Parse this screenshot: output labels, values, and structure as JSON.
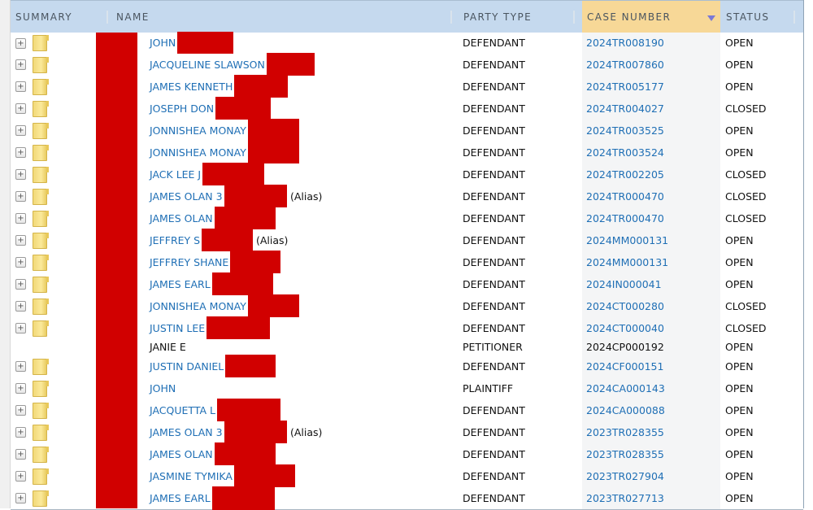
{
  "columns": {
    "summary": "SUMMARY",
    "name": "NAME",
    "party_type": "PARTY TYPE",
    "case_number": "CASE NUMBER",
    "status": "STATUS"
  },
  "sort": {
    "column": "case_number",
    "direction": "descending"
  },
  "colors": {
    "link": "#1f6fb5",
    "header_bg": "#c5d9ee",
    "sorted_header_bg": "#f7d897",
    "redaction": "#d10000"
  },
  "rows": [
    {
      "name": "JOHN",
      "alias": "",
      "party_type": "DEFENDANT",
      "case_number": "2024TR008190",
      "status": "OPEN",
      "expandable": true,
      "case_link": true
    },
    {
      "name": "JACQUELINE SLAWSON",
      "alias": "",
      "party_type": "DEFENDANT",
      "case_number": "2024TR007860",
      "status": "OPEN",
      "expandable": true,
      "case_link": true
    },
    {
      "name": "JAMES KENNETH",
      "alias": "",
      "party_type": "DEFENDANT",
      "case_number": "2024TR005177",
      "status": "OPEN",
      "expandable": true,
      "case_link": true
    },
    {
      "name": "JOSEPH DON",
      "alias": "",
      "party_type": "DEFENDANT",
      "case_number": "2024TR004027",
      "status": "CLOSED",
      "expandable": true,
      "case_link": true
    },
    {
      "name": "JONNISHEA MONAY",
      "alias": "",
      "party_type": "DEFENDANT",
      "case_number": "2024TR003525",
      "status": "OPEN",
      "expandable": true,
      "case_link": true
    },
    {
      "name": "JONNISHEA MONAY",
      "alias": "",
      "party_type": "DEFENDANT",
      "case_number": "2024TR003524",
      "status": "OPEN",
      "expandable": true,
      "case_link": true
    },
    {
      "name": "JACK LEE J",
      "alias": "",
      "party_type": "DEFENDANT",
      "case_number": "2024TR002205",
      "status": "CLOSED",
      "expandable": true,
      "case_link": true
    },
    {
      "name": "JAMES OLAN 3",
      "alias": "(Alias)",
      "party_type": "DEFENDANT",
      "case_number": "2024TR000470",
      "status": "CLOSED",
      "expandable": true,
      "case_link": true
    },
    {
      "name": "JAMES OLAN",
      "alias": "",
      "party_type": "DEFENDANT",
      "case_number": "2024TR000470",
      "status": "CLOSED",
      "expandable": true,
      "case_link": true
    },
    {
      "name": "JEFFREY S",
      "alias": "(Alias)",
      "party_type": "DEFENDANT",
      "case_number": "2024MM000131",
      "status": "OPEN",
      "expandable": true,
      "case_link": true
    },
    {
      "name": "JEFFREY SHANE",
      "alias": "",
      "party_type": "DEFENDANT",
      "case_number": "2024MM000131",
      "status": "OPEN",
      "expandable": true,
      "case_link": true
    },
    {
      "name": "JAMES EARL",
      "alias": "",
      "party_type": "DEFENDANT",
      "case_number": "2024IN000041",
      "status": "OPEN",
      "expandable": true,
      "case_link": true
    },
    {
      "name": "JONNISHEA MONAY",
      "alias": "",
      "party_type": "DEFENDANT",
      "case_number": "2024CT000280",
      "status": "CLOSED",
      "expandable": true,
      "case_link": true
    },
    {
      "name": "JUSTIN LEE",
      "alias": "",
      "party_type": "DEFENDANT",
      "case_number": "2024CT000040",
      "status": "CLOSED",
      "expandable": true,
      "case_link": true
    },
    {
      "name": "JANIE E",
      "alias": "",
      "party_type": "PETITIONER",
      "case_number": "2024CP000192",
      "status": "OPEN",
      "expandable": false,
      "case_link": false
    },
    {
      "name": "JUSTIN DANIEL",
      "alias": "",
      "party_type": "DEFENDANT",
      "case_number": "2024CF000151",
      "status": "OPEN",
      "expandable": true,
      "case_link": true
    },
    {
      "name": "JOHN",
      "alias": "",
      "party_type": "PLAINTIFF",
      "case_number": "2024CA000143",
      "status": "OPEN",
      "expandable": true,
      "case_link": true
    },
    {
      "name": "JACQUETTA L",
      "alias": "",
      "party_type": "DEFENDANT",
      "case_number": "2024CA000088",
      "status": "OPEN",
      "expandable": true,
      "case_link": true
    },
    {
      "name": "JAMES OLAN 3",
      "alias": "(Alias)",
      "party_type": "DEFENDANT",
      "case_number": "2023TR028355",
      "status": "OPEN",
      "expandable": true,
      "case_link": true
    },
    {
      "name": "JAMES OLAN",
      "alias": "",
      "party_type": "DEFENDANT",
      "case_number": "2023TR028355",
      "status": "OPEN",
      "expandable": true,
      "case_link": true
    },
    {
      "name": "JASMINE TYMIKA",
      "alias": "",
      "party_type": "DEFENDANT",
      "case_number": "2023TR027904",
      "status": "OPEN",
      "expandable": true,
      "case_link": true
    },
    {
      "name": "JAMES EARL",
      "alias": "",
      "party_type": "DEFENDANT",
      "case_number": "2023TR027713",
      "status": "OPEN",
      "expandable": true,
      "case_link": true
    }
  ]
}
